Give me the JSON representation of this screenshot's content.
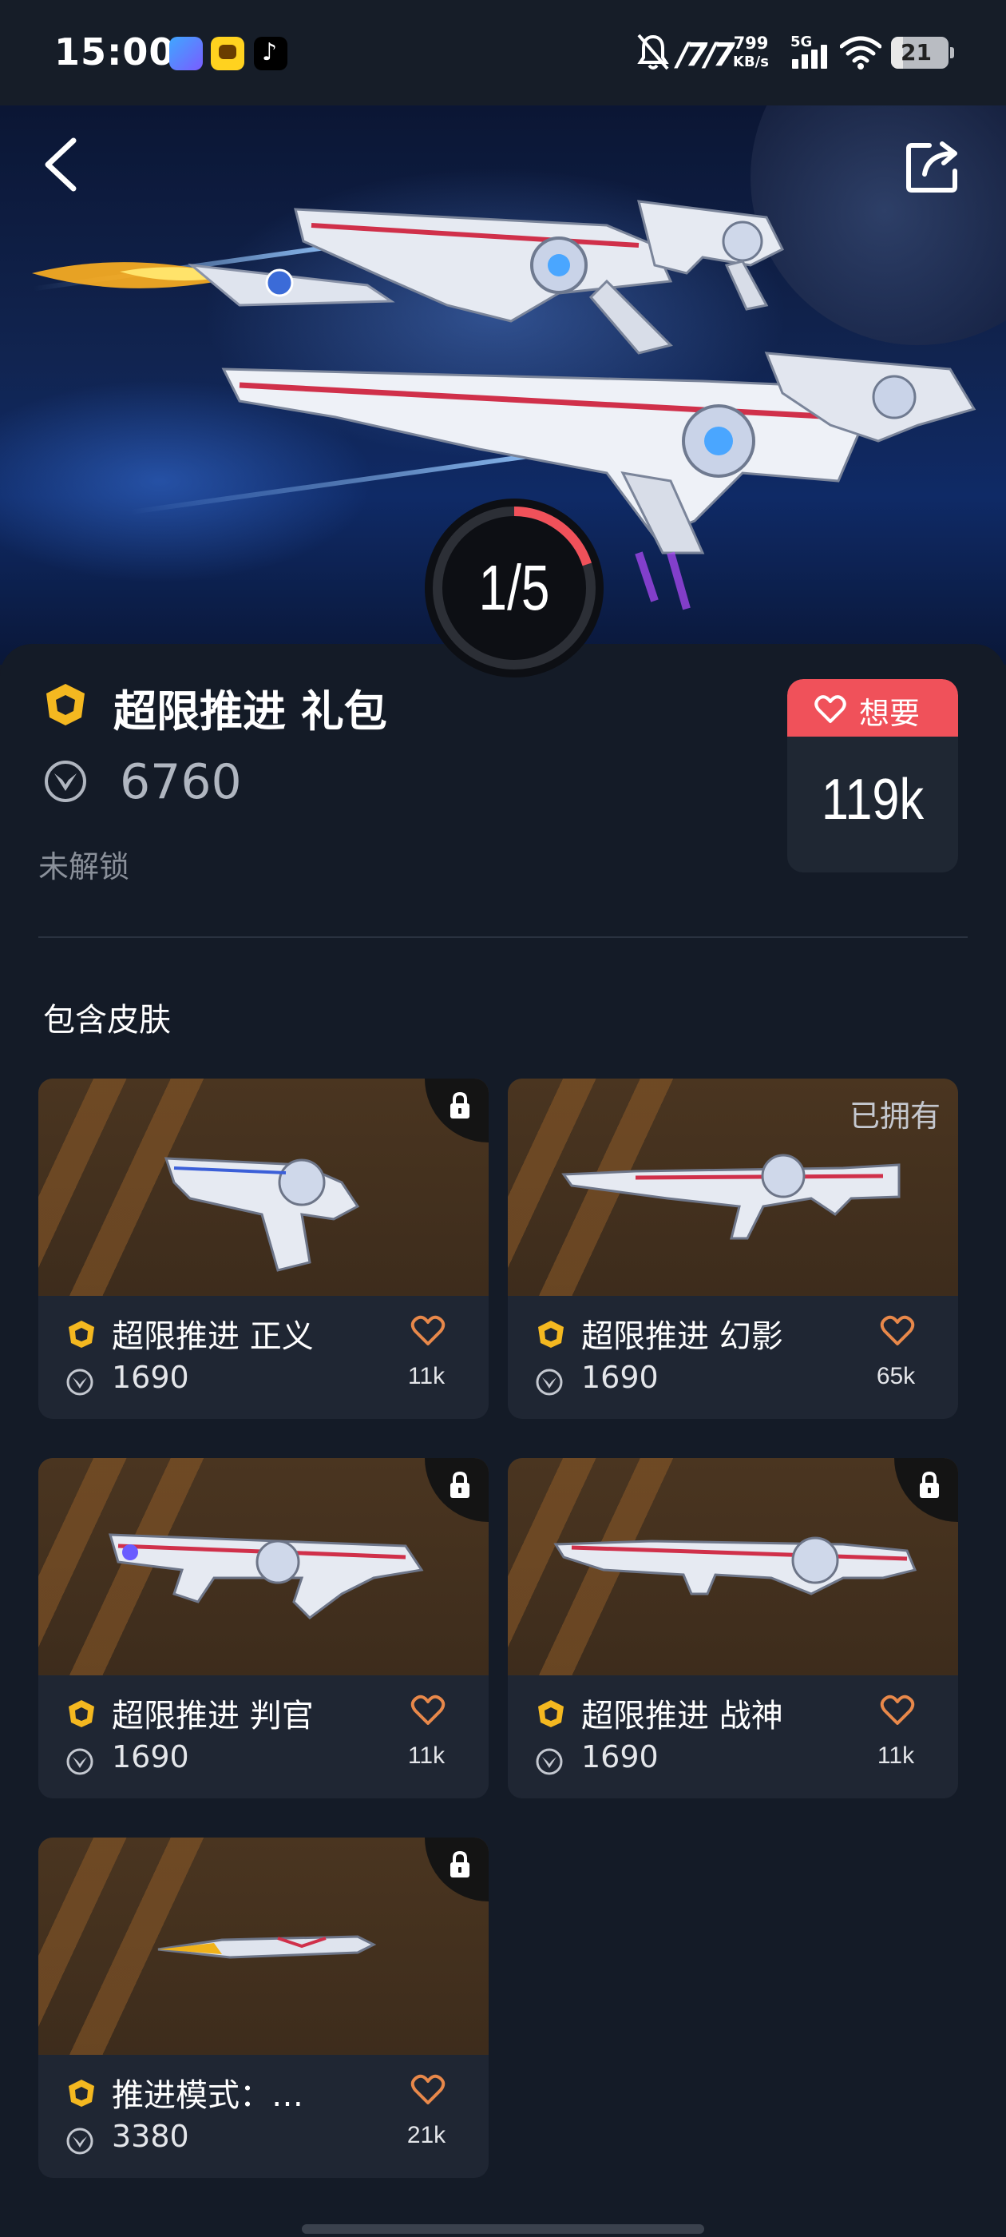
{
  "status_bar": {
    "time": "15:00",
    "net_speed_value": "799",
    "net_speed_unit": "KB/s",
    "network": "5G",
    "battery": "21",
    "battery_level": 0.21
  },
  "hero": {
    "pager": "1/5",
    "pager_progress": 0.2
  },
  "bundle": {
    "title": "超限推进 礼包",
    "price": "6760",
    "status": "未解锁",
    "wish_label": "想要",
    "wish_count": "119k"
  },
  "section": {
    "title": "包含皮肤"
  },
  "skins": [
    {
      "name": "超限推进 正义",
      "price": "1690",
      "likes": "11k",
      "locked": true,
      "owned_label": ""
    },
    {
      "name": "超限推进 幻影",
      "price": "1690",
      "likes": "65k",
      "locked": false,
      "owned_label": "已拥有"
    },
    {
      "name": "超限推进 判官",
      "price": "1690",
      "likes": "11k",
      "locked": true,
      "owned_label": ""
    },
    {
      "name": "超限推进 战神",
      "price": "1690",
      "likes": "11k",
      "locked": true,
      "owned_label": ""
    },
    {
      "name": "推进模式：…",
      "price": "3380",
      "likes": "21k",
      "locked": true,
      "owned_label": ""
    }
  ],
  "colors": {
    "background": "#141b27",
    "card": "#1f2633",
    "accent_red": "#f0515a",
    "tier_gold": "#f4b820",
    "heart_orange": "#e8884a"
  },
  "icons": {
    "back": "back-arrow-icon",
    "share": "share-icon",
    "tier": "premium-edition-icon",
    "currency": "valorant-points-icon",
    "heart": "heart-icon",
    "lock": "lock-icon"
  }
}
